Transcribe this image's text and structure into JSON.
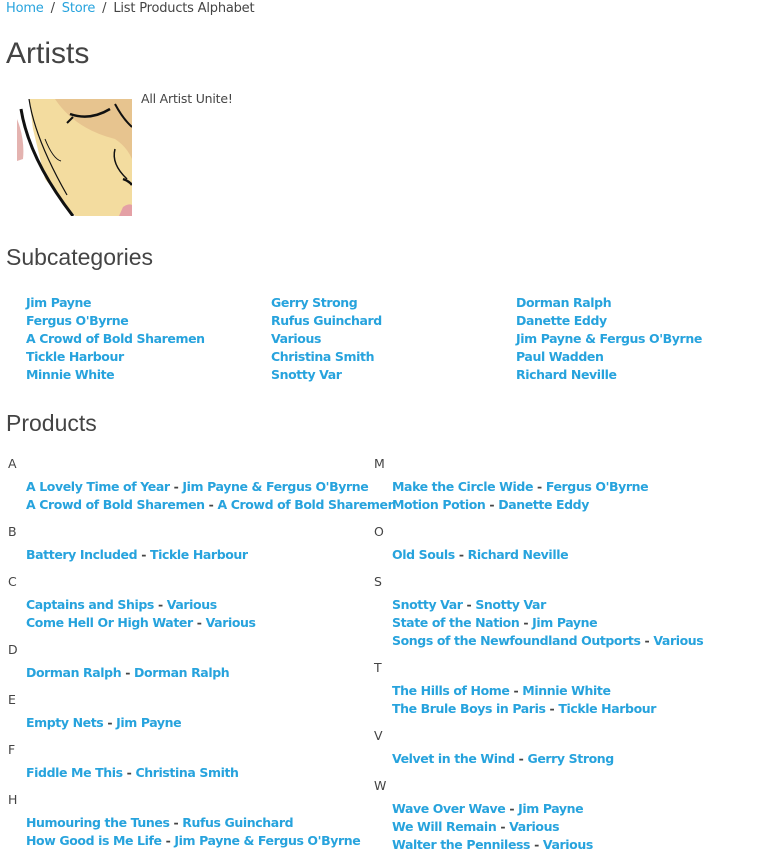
{
  "breadcrumb": {
    "items": [
      {
        "label": "Home",
        "link": true
      },
      {
        "label": "Store",
        "link": true
      },
      {
        "label": "List Products Alphabet",
        "link": false
      }
    ],
    "separator": "/"
  },
  "page": {
    "title": "Artists",
    "description": "All Artist Unite!",
    "image_alt": "comic-style face illustration"
  },
  "colors": {
    "link": "#27a3dd",
    "text": "#444444"
  },
  "subcategories": {
    "heading": "Subcategories",
    "columns": [
      [
        "Jim Payne",
        "Fergus O'Byrne",
        "A Crowd of Bold Sharemen",
        "Tickle Harbour",
        "Minnie White"
      ],
      [
        "Gerry Strong",
        "Rufus Guinchard",
        "Various",
        "Christina Smith",
        "Snotty Var"
      ],
      [
        "Dorman Ralph",
        "Danette Eddy",
        "Jim Payne & Fergus O'Byrne",
        "Paul Wadden",
        "Richard Neville"
      ]
    ]
  },
  "products": {
    "heading": "Products",
    "separator": "-",
    "columns": [
      [
        {
          "letter": "A",
          "items": [
            {
              "title": "A Lovely Time of Year",
              "artist": "Jim Payne & Fergus O'Byrne"
            },
            {
              "title": "A Crowd of Bold Sharemen",
              "artist": "A Crowd of Bold Sharemen"
            }
          ]
        },
        {
          "letter": "B",
          "items": [
            {
              "title": "Battery Included",
              "artist": "Tickle Harbour"
            }
          ]
        },
        {
          "letter": "C",
          "items": [
            {
              "title": "Captains and Ships",
              "artist": "Various"
            },
            {
              "title": "Come Hell Or High Water",
              "artist": "Various"
            }
          ]
        },
        {
          "letter": "D",
          "items": [
            {
              "title": "Dorman Ralph",
              "artist": "Dorman Ralph"
            }
          ]
        },
        {
          "letter": "E",
          "items": [
            {
              "title": "Empty Nets",
              "artist": "Jim Payne"
            }
          ]
        },
        {
          "letter": "F",
          "items": [
            {
              "title": "Fiddle Me This",
              "artist": "Christina Smith"
            }
          ]
        },
        {
          "letter": "H",
          "items": [
            {
              "title": "Humouring the Tunes",
              "artist": "Rufus Guinchard"
            },
            {
              "title": "How Good is Me Life",
              "artist": "Jim Payne & Fergus O'Byrne"
            }
          ]
        }
      ],
      [
        {
          "letter": "M",
          "items": [
            {
              "title": "Make the Circle Wide",
              "artist": "Fergus O'Byrne"
            },
            {
              "title": "Motion Potion",
              "artist": "Danette Eddy"
            }
          ]
        },
        {
          "letter": "O",
          "items": [
            {
              "title": "Old Souls",
              "artist": "Richard Neville"
            }
          ]
        },
        {
          "letter": "S",
          "items": [
            {
              "title": "Snotty Var",
              "artist": "Snotty Var"
            },
            {
              "title": "State of the Nation",
              "artist": "Jim Payne"
            },
            {
              "title": "Songs of the Newfoundland Outports",
              "artist": "Various"
            }
          ]
        },
        {
          "letter": "T",
          "items": [
            {
              "title": "The Hills of Home",
              "artist": "Minnie White"
            },
            {
              "title": "The Brule Boys in Paris",
              "artist": "Tickle Harbour"
            }
          ]
        },
        {
          "letter": "V",
          "items": [
            {
              "title": "Velvet in the Wind",
              "artist": "Gerry Strong"
            }
          ]
        },
        {
          "letter": "W",
          "items": [
            {
              "title": "Wave Over Wave",
              "artist": "Jim Payne"
            },
            {
              "title": "We Will Remain",
              "artist": "Various"
            },
            {
              "title": "Walter the Penniless",
              "artist": "Various"
            }
          ]
        }
      ]
    ]
  }
}
